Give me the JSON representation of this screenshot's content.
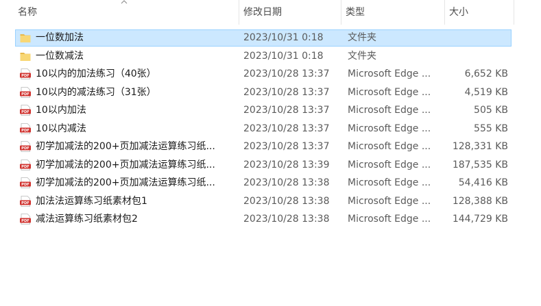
{
  "header": {
    "name": "名称",
    "date": "修改日期",
    "type": "类型",
    "size": "大小"
  },
  "colors": {
    "selection_bg": "#cce8ff",
    "selection_border": "#99d1ff",
    "folder": "#f8d775",
    "pdf": "#d0312d"
  },
  "files": [
    {
      "icon": "folder-icon",
      "name": "一位数加法",
      "date": "2023/10/31 0:18",
      "type": "文件夹",
      "size": ""
    },
    {
      "icon": "folder-icon",
      "name": "一位数减法",
      "date": "2023/10/31 0:18",
      "type": "文件夹",
      "size": ""
    },
    {
      "icon": "pdf-icon",
      "name": "10以内的加法练习（40张）",
      "date": "2023/10/28 13:37",
      "type": "Microsoft Edge ...",
      "size": "6,652 KB"
    },
    {
      "icon": "pdf-icon",
      "name": "10以内的减法练习（31张）",
      "date": "2023/10/28 13:37",
      "type": "Microsoft Edge ...",
      "size": "4,519 KB"
    },
    {
      "icon": "pdf-icon",
      "name": "10以内加法",
      "date": "2023/10/28 13:37",
      "type": "Microsoft Edge ...",
      "size": "505 KB"
    },
    {
      "icon": "pdf-icon",
      "name": "10以内减法",
      "date": "2023/10/28 13:37",
      "type": "Microsoft Edge ...",
      "size": "555 KB"
    },
    {
      "icon": "pdf-icon",
      "name": "初学加减法的200+页加减法运算练习纸...",
      "date": "2023/10/28 13:37",
      "type": "Microsoft Edge ...",
      "size": "128,331 KB"
    },
    {
      "icon": "pdf-icon",
      "name": "初学加减法的200+页加减法运算练习纸...",
      "date": "2023/10/28 13:39",
      "type": "Microsoft Edge ...",
      "size": "187,535 KB"
    },
    {
      "icon": "pdf-icon",
      "name": "初学加减法的200+页加减法运算练习纸...",
      "date": "2023/10/28 13:38",
      "type": "Microsoft Edge ...",
      "size": "54,416 KB"
    },
    {
      "icon": "pdf-icon",
      "name": "加法法运算练习纸素材包1",
      "date": "2023/10/28 13:38",
      "type": "Microsoft Edge ...",
      "size": "128,388 KB"
    },
    {
      "icon": "pdf-icon",
      "name": "减法运算练习纸素材包2",
      "date": "2023/10/28 13:38",
      "type": "Microsoft Edge ...",
      "size": "144,729 KB"
    }
  ]
}
